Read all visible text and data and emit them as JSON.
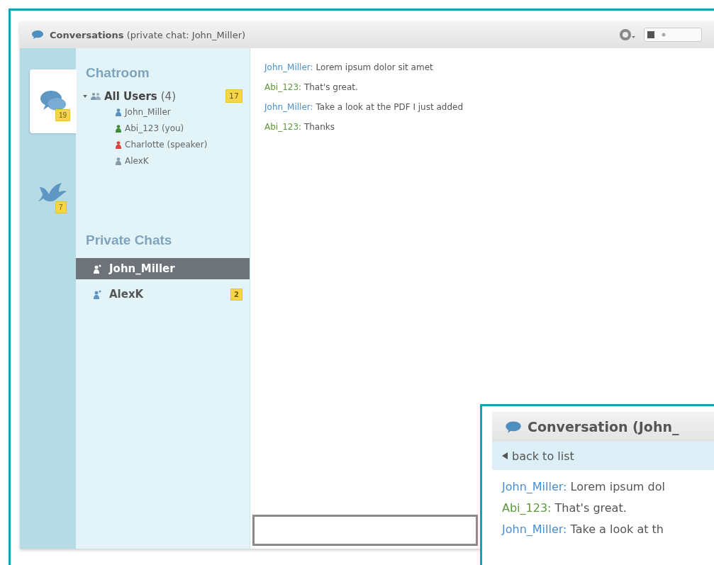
{
  "window": {
    "title": "Conversations",
    "subtitle": "(private chat: John_Miller)"
  },
  "rail_tabs": [
    {
      "kind": "chat",
      "badge": "19",
      "selected": true
    },
    {
      "kind": "bird",
      "badge": "7",
      "selected": false
    }
  ],
  "chatroom": {
    "heading": "Chatroom",
    "group": {
      "label": "All Users",
      "count": "(4)",
      "badge": "17",
      "expanded": true,
      "users": [
        {
          "name": "John_Miller",
          "color": "#5b8fc0"
        },
        {
          "name": "Abi_123 (you)",
          "color": "#3f8a3a"
        },
        {
          "name": "Charlotte (speaker)",
          "color": "#d9453c"
        },
        {
          "name": "AlexK",
          "color": "#8a9aa6"
        }
      ]
    }
  },
  "private_chats": {
    "heading": "Private Chats",
    "items": [
      {
        "name": "John_Miller",
        "selected": true
      },
      {
        "name": "AlexK",
        "selected": false,
        "badge": "2"
      }
    ]
  },
  "messages": [
    {
      "author": "John_Miller:",
      "color": "#4a90d0",
      "text": "Lorem ipsum dolor sit amet"
    },
    {
      "author": "Abi_123:",
      "color": "#5a9a3a",
      "text": "That's great."
    },
    {
      "author": "John_Miller:",
      "color": "#4a90d0",
      "text": "Take a look at the PDF I just added"
    },
    {
      "author": "Abi_123:",
      "color": "#5a9a3a",
      "text": "Thanks"
    }
  ],
  "mobile": {
    "title": "Conversation (John_",
    "back": "back to list",
    "messages": [
      {
        "author": "John_Miller:",
        "color": "#4a90d0",
        "text": "Lorem ipsum dol"
      },
      {
        "author": "Abi_123:",
        "color": "#5a9a3a",
        "text": "That's great."
      },
      {
        "author": "John_Miller:",
        "color": "#4a90d0",
        "text": "Take a look at th"
      }
    ]
  }
}
